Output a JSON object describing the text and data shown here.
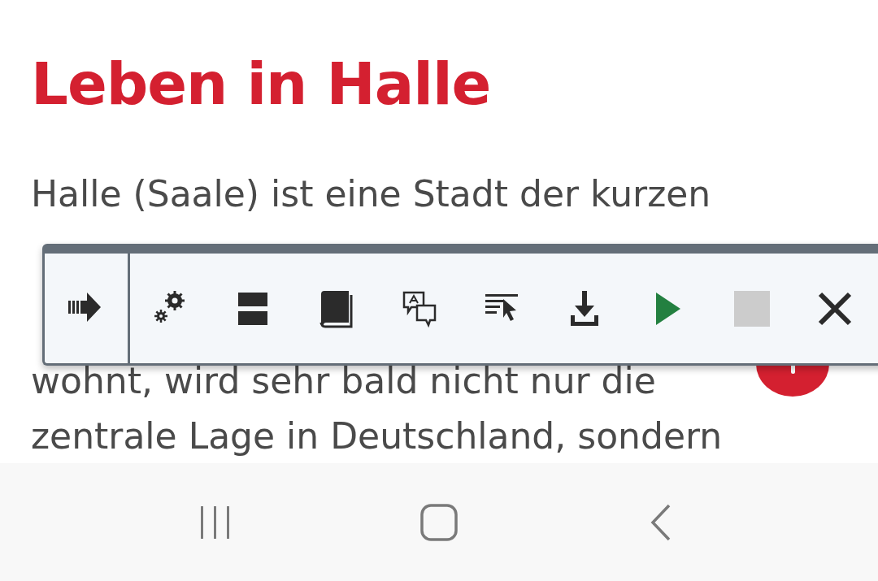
{
  "article": {
    "title": "Leben in Halle",
    "lines_before": [
      "Halle (Saale) ist eine Stadt der kurzen"
    ],
    "lines_after": [
      "wohnt, wird sehr bald nicht nur die",
      "zentrale Lage in Deutschland, sondern"
    ]
  },
  "toolbar": {
    "buttons": [
      {
        "kind": "skip",
        "disabled": false
      },
      {
        "kind": "settings",
        "disabled": false
      },
      {
        "kind": "layout",
        "disabled": false
      },
      {
        "kind": "book",
        "disabled": false
      },
      {
        "kind": "translate",
        "disabled": false
      },
      {
        "kind": "select",
        "disabled": false
      },
      {
        "kind": "download",
        "disabled": false
      },
      {
        "kind": "play",
        "disabled": false
      },
      {
        "kind": "stop",
        "disabled": true
      },
      {
        "kind": "close",
        "disabled": false
      }
    ]
  },
  "nav": [
    {
      "kind": "recent"
    },
    {
      "kind": "home"
    },
    {
      "kind": "back"
    }
  ]
}
